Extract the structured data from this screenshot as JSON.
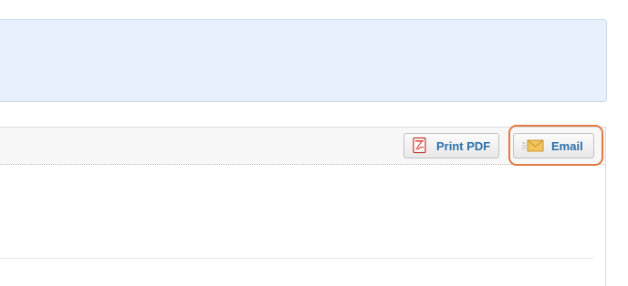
{
  "toolbar": {
    "print_pdf_label": "Print PDF",
    "email_label": "Email"
  }
}
